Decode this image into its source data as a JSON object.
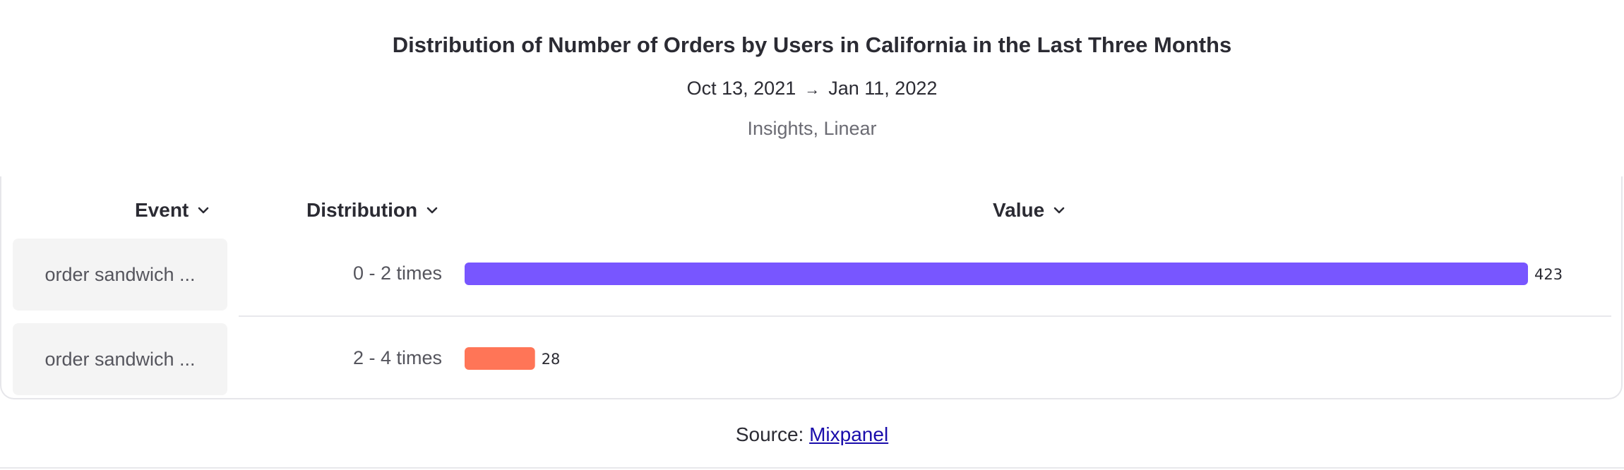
{
  "header": {
    "title": "Distribution of Number of Orders by Users in California in the Last Three Months",
    "date_start": "Oct 13, 2021",
    "date_arrow": "→",
    "date_end": "Jan 11, 2022",
    "subtitle": "Insights, Linear"
  },
  "table": {
    "columns": {
      "event": "Event",
      "distribution": "Distribution",
      "value": "Value"
    },
    "rows": [
      {
        "event": "order sandwich ...",
        "distribution": "0 - 2 times",
        "value": 423,
        "value_label": "423",
        "color": "#7856FF"
      },
      {
        "event": "order sandwich ...",
        "distribution": "2 - 4 times",
        "value": 28,
        "value_label": "28",
        "color": "#FF7557"
      }
    ]
  },
  "chart_data": {
    "type": "bar",
    "orientation": "horizontal",
    "categories": [
      "0 - 2 times",
      "2 - 4 times"
    ],
    "values": [
      423,
      28
    ],
    "colors": [
      "#7856FF",
      "#FF7557"
    ],
    "title": "Distribution of Number of Orders by Users in California in the Last Three Months"
  },
  "footer": {
    "source_prefix": "Source: ",
    "source_link": "Mixpanel"
  }
}
